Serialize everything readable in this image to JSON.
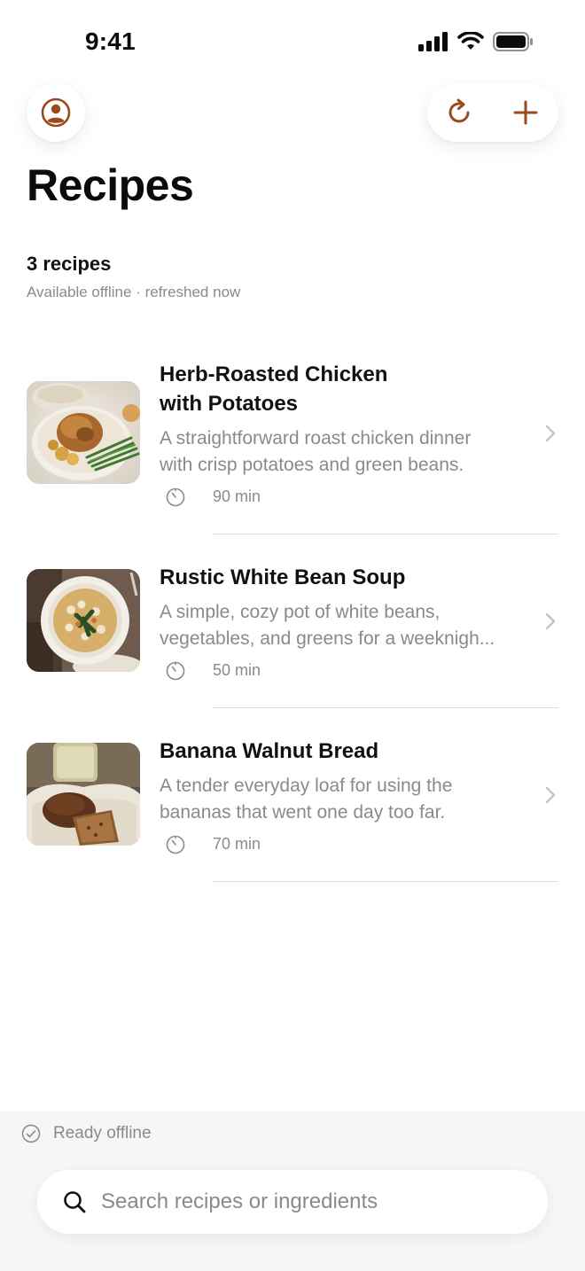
{
  "status_bar": {
    "time": "9:41",
    "icons": [
      "cellular-signal-icon",
      "wifi-icon",
      "battery-icon"
    ]
  },
  "header": {
    "profile_icon": "person-circle-icon",
    "refresh_icon": "refresh-icon",
    "add_icon": "plus-icon",
    "title": "Recipes"
  },
  "summary": {
    "count": "3 recipes",
    "status": "Available offline · refreshed now"
  },
  "recipes": [
    {
      "title_line1": "Herb-Roasted Chicken",
      "title_line2": "with Potatoes",
      "desc_line1": "A straightforward roast chicken dinner",
      "desc_line2": "with crisp potatoes and green beans.",
      "time": "90 min"
    },
    {
      "title_line1": "Rustic White Bean Soup",
      "title_line2": "",
      "desc_line1": "A simple, cozy pot of white beans,",
      "desc_line2": "vegetables, and greens for a weeknigh...",
      "time": "50 min"
    },
    {
      "title_line1": "Banana Walnut Bread",
      "title_line2": "",
      "desc_line1": "A tender everyday loaf for using the",
      "desc_line2": "bananas that went one day too far.",
      "time": "70 min"
    }
  ],
  "footer": {
    "offline_label": "Ready offline",
    "search_placeholder": "Search recipes or ingredients",
    "search_value": ""
  },
  "colors": {
    "accent": "#9a4a1c",
    "text_primary": "#111111",
    "text_secondary": "#8a8a8a",
    "divider": "#dedede",
    "bottom_panel": "#f6f6f6"
  }
}
